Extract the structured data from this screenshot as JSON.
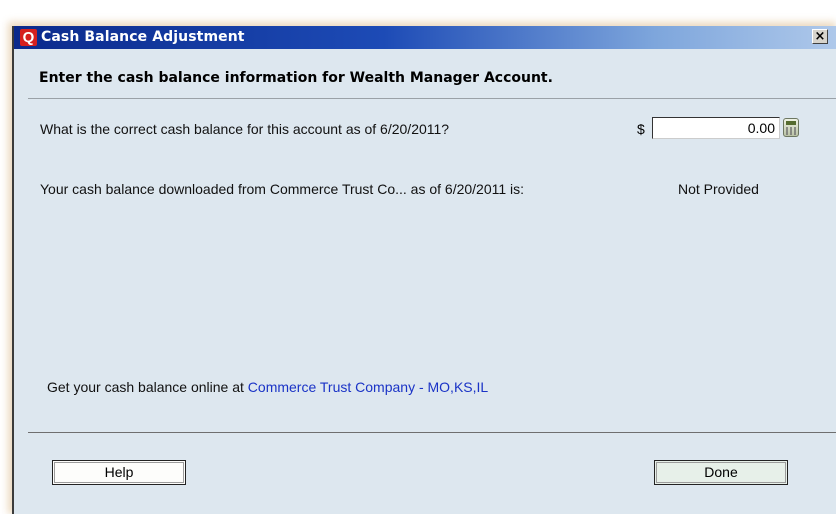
{
  "window": {
    "title": "Cash Balance Adjustment",
    "logo_letter": "Q",
    "close_glyph": "×",
    "heading": "Enter the cash balance information for Wealth Manager Account."
  },
  "form": {
    "question": "What is the correct cash balance for this account as of 6/20/2011?",
    "currency_symbol": "$",
    "amount_value": "0.00",
    "downloaded_label": "Your cash balance downloaded from Commerce Trust Co... as of 6/20/2011 is:",
    "downloaded_value": "Not Provided",
    "online_prefix": "Get your cash balance online at ",
    "online_link": "Commerce Trust Company - MO,KS,IL"
  },
  "buttons": {
    "help": "Help",
    "done": "Done"
  },
  "icons": {
    "logo": "quicken-logo-icon",
    "close": "close-icon",
    "calculator": "calculator-icon"
  },
  "colors": {
    "title_gradient_start": "#0b2a8c",
    "body_background": "#dde7ef",
    "link": "#1a33c6"
  }
}
